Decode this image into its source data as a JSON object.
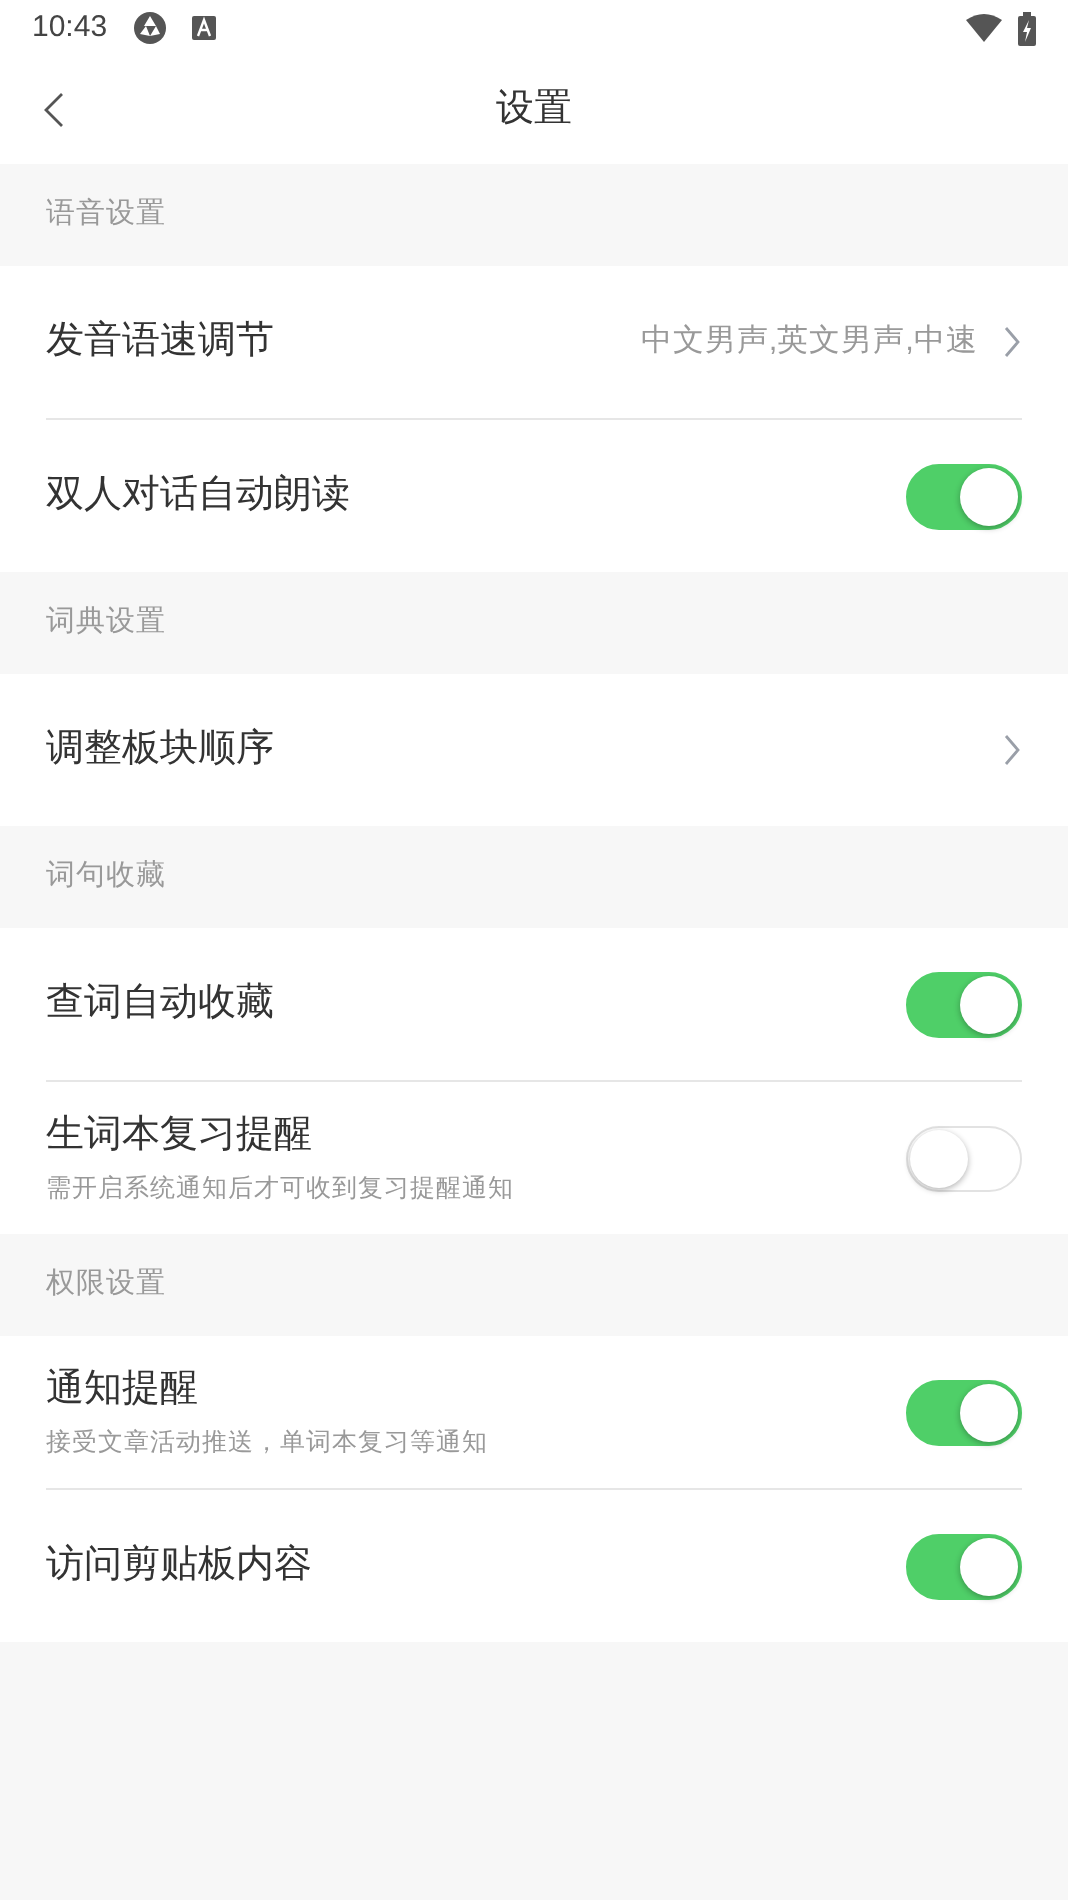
{
  "status_bar": {
    "time": "10:43"
  },
  "header": {
    "title": "设置"
  },
  "sections": [
    {
      "title": "语音设置",
      "rows": [
        {
          "kind": "link",
          "label": "发音语速调节",
          "value": "中文男声,英文男声,中速"
        },
        {
          "kind": "toggle",
          "label": "双人对话自动朗读",
          "on": true
        }
      ]
    },
    {
      "title": "词典设置",
      "rows": [
        {
          "kind": "link",
          "label": "调整板块顺序"
        }
      ]
    },
    {
      "title": "词句收藏",
      "rows": [
        {
          "kind": "toggle",
          "label": "查词自动收藏",
          "on": true
        },
        {
          "kind": "toggle",
          "label": "生词本复习提醒",
          "hint": "需开启系统通知后才可收到复习提醒通知",
          "on": false
        }
      ]
    },
    {
      "title": "权限设置",
      "rows": [
        {
          "kind": "toggle",
          "label": "通知提醒",
          "hint": "接受文章活动推送，单词本复习等通知",
          "on": true
        },
        {
          "kind": "toggle",
          "label": "访问剪贴板内容",
          "on": true
        }
      ]
    }
  ]
}
